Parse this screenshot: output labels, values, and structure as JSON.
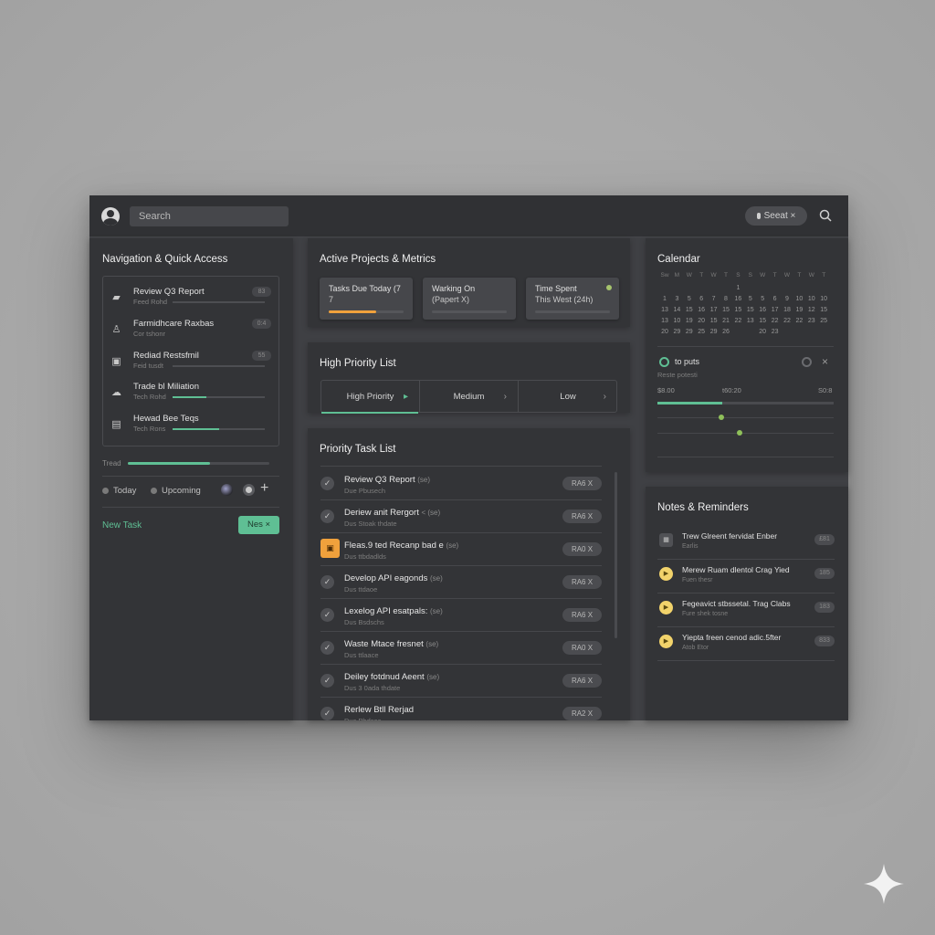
{
  "topbar": {
    "search_placeholder": "Search",
    "pill_label": "Seeat ×"
  },
  "nav": {
    "title": "Navigation & Quick Access",
    "items": [
      {
        "label": "Review Q3 Report",
        "sub": "Feed Rohd",
        "badge": "83",
        "progress": 0
      },
      {
        "label": "Farmidhcare Raxbas",
        "sub": "Cor tshonr",
        "badge": "0:4",
        "progress": null
      },
      {
        "label": "Rediad Restsfmil",
        "sub": "Feid tusdt",
        "badge": "55",
        "progress": 0
      },
      {
        "label": "Trade bl Miliation",
        "sub": "Tech Rohd",
        "badge": "",
        "progress": 0.37
      },
      {
        "label": "Hewad Bee Teqs",
        "sub": "Tech Rons",
        "badge": "",
        "progress": 0.5
      }
    ],
    "progress_label": "Tread",
    "progress": 0.58,
    "filters": {
      "today": "Today",
      "upcoming": "Upcoming"
    },
    "new_task_label": "New Task",
    "new_button": "Nes ×"
  },
  "metrics": {
    "title": "Active Projects & Metrics",
    "cards": [
      {
        "line1": "Tasks Due Today (7",
        "line2": "7",
        "progress": 0.63
      },
      {
        "line1": "Warking On",
        "line2": "(Papert X)",
        "progress": 0
      },
      {
        "line1": "Time Spent",
        "line2": "This West (24h)",
        "progress": 0
      }
    ]
  },
  "high_priority": {
    "title": "High Priority List",
    "segments": [
      "High Priority",
      "Medium",
      "Low"
    ],
    "active": "High Priority"
  },
  "priority_tasks": {
    "title": "Priority Task List",
    "items": [
      {
        "title": "Review Q3 Report",
        "paren": "(se)",
        "sub": "Due Pbusech",
        "tag": "RA6 X",
        "flag": false
      },
      {
        "title": "Deriew anit Rergort",
        "paren": "< (se)",
        "sub": "Dus Stoak thdate",
        "tag": "RA6 X",
        "flag": false
      },
      {
        "title": "Fleas.9 ted Recanp bad e",
        "paren": "(se)",
        "sub": "Dus ttbdadlds",
        "tag": "RA0 X",
        "flag": true
      },
      {
        "title": "Develop API eagonds",
        "paren": "(se)",
        "sub": "Dus ttdaoe",
        "tag": "RA6 X",
        "flag": false
      },
      {
        "title": "Lexelog API esatpals:",
        "paren": "(se)",
        "sub": "Dus Bsdschs",
        "tag": "RA6 X",
        "flag": false
      },
      {
        "title": "Waste Mtace fresnet",
        "paren": "(se)",
        "sub": "Dus ttlaace",
        "tag": "RA0 X",
        "flag": false
      },
      {
        "title": "Deiley fotdnud Aeent",
        "paren": "(se)",
        "sub": "Dus 3 0ada thdate",
        "tag": "RA6 X",
        "flag": false
      },
      {
        "title": "Rerlew Btll Rerjad",
        "paren": "",
        "sub": "Dus Pbdsec",
        "tag": "RA2 X",
        "flag": false
      }
    ]
  },
  "calendar": {
    "title": "Calendar",
    "day_heads": [
      "Sw",
      "M",
      "W",
      "T",
      "W",
      "T",
      "S",
      "S",
      "W",
      "T",
      "W",
      "T",
      "W",
      "T"
    ],
    "rows": [
      [
        "",
        "",
        "",
        "",
        "",
        "",
        "1",
        "",
        "",
        "",
        "",
        "",
        "",
        ""
      ],
      [
        "1",
        "3",
        "5",
        "6",
        "7",
        "8",
        "16",
        "5",
        "5",
        "6",
        "9",
        "10",
        "10",
        "10"
      ],
      [
        "13",
        "14",
        "15",
        "16",
        "17",
        "15",
        "15",
        "15",
        "16",
        "17",
        "18",
        "19",
        "12",
        "15"
      ],
      [
        "13",
        "10",
        "19",
        "20",
        "15",
        "21",
        "22",
        "13",
        "15",
        "22",
        "22",
        "22",
        "23",
        "25"
      ],
      [
        "20",
        "29",
        "29",
        "25",
        "29",
        "26",
        "",
        "",
        "20",
        "23",
        "",
        "",
        "",
        ""
      ]
    ],
    "top_row": [
      "",
      "",
      "",
      "",
      "",
      "",
      "1",
      "",
      "",
      "",
      "",
      "",
      "",
      ""
    ],
    "event_label": "to puts",
    "event_sub": "Reste potesti",
    "time_start": "$8.00",
    "time_mid": "t60:20",
    "time_end": "S0:8",
    "progress": 0.37,
    "accent": "#5fbf94"
  },
  "notes": {
    "title": "Notes & Reminders",
    "items": [
      {
        "title": "Trew Glreent fervidat Enber",
        "sub": "Earlis",
        "badge": "£81",
        "icon": "calendar-icon"
      },
      {
        "title": "Merew Ruam dlentol Crag Yied",
        "sub": "Fuen thesr",
        "badge": "185",
        "icon": "play-icon"
      },
      {
        "title": "Fegeavict stbssetal. Trag Clabs",
        "sub": "Fure shek tosne",
        "badge": "183",
        "icon": "play-icon"
      },
      {
        "title": "Yiepta freen cenod adic.5fter",
        "sub": "Atob Etor",
        "badge": "833",
        "icon": "play-icon"
      }
    ]
  }
}
